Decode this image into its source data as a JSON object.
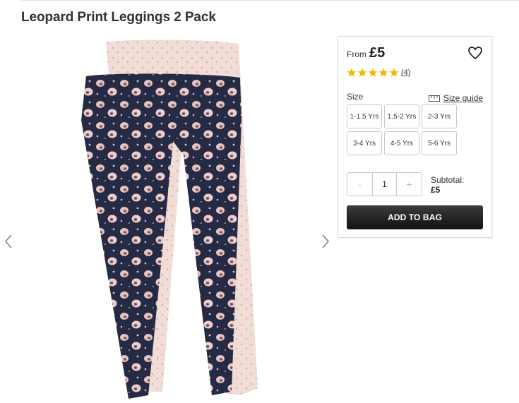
{
  "product": {
    "title": "Leopard Print Leggings 2 Pack",
    "image_icon": "leggings-product-image"
  },
  "gallery": {
    "prev_icon": "chevron-left-icon",
    "next_icon": "chevron-right-icon"
  },
  "buybox": {
    "price_prefix": "From",
    "price": "£5",
    "wishlist_icon": "heart-icon",
    "rating": {
      "stars": 5,
      "reviews": "(4)",
      "star_color": "#f5b800"
    },
    "size_label": "Size",
    "size_guide_label": "Size guide",
    "size_guide_icon": "ruler-icon",
    "sizes": [
      "1-1.5 Yrs",
      "1.5-2 Yrs",
      "2-3 Yrs",
      "3-4 Yrs",
      "4-5 Yrs",
      "5-6 Yrs"
    ],
    "quantity": {
      "decrement": "-",
      "value": "1",
      "increment": "+"
    },
    "subtotal_label": "Subtotal:",
    "subtotal_value": "£5",
    "add_to_bag": "ADD TO BAG",
    "button_color": "#1a1a1a"
  }
}
